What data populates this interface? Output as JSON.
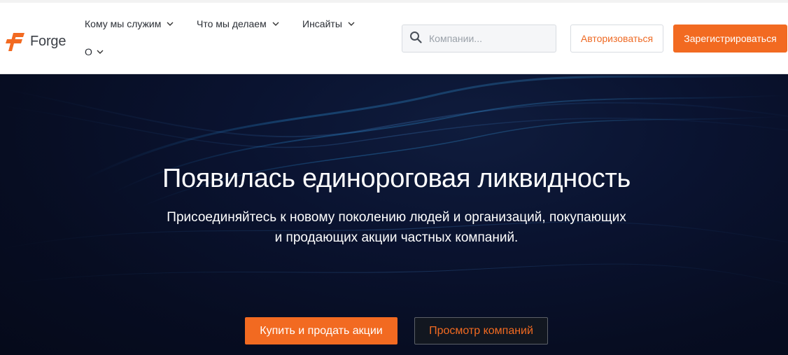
{
  "brand": {
    "name": "Forge",
    "accent_color": "#f26a21"
  },
  "nav": {
    "items": [
      {
        "label": "Кому мы служим",
        "icon": "chevron-down-icon"
      },
      {
        "label": "Что мы делаем",
        "icon": "chevron-down-icon"
      },
      {
        "label": "Инсайты",
        "icon": "chevron-down-icon"
      },
      {
        "label": "О",
        "icon": "chevron-down-icon"
      }
    ]
  },
  "search": {
    "placeholder": "Компании...",
    "value": "",
    "icon": "search-icon"
  },
  "auth": {
    "login_label": "Авторизоваться",
    "register_label": "Зарегистрироваться"
  },
  "hero": {
    "title": "Появилась единороговая ликвидность",
    "subtitle_line1": "Присоединяйтесь к новому поколению людей и организаций, покупающих",
    "subtitle_line2": "и продающих акции частных компаний.",
    "primary_cta": "Купить и продать акции",
    "secondary_cta": "Просмотр компаний",
    "background_color": "#070d22"
  }
}
